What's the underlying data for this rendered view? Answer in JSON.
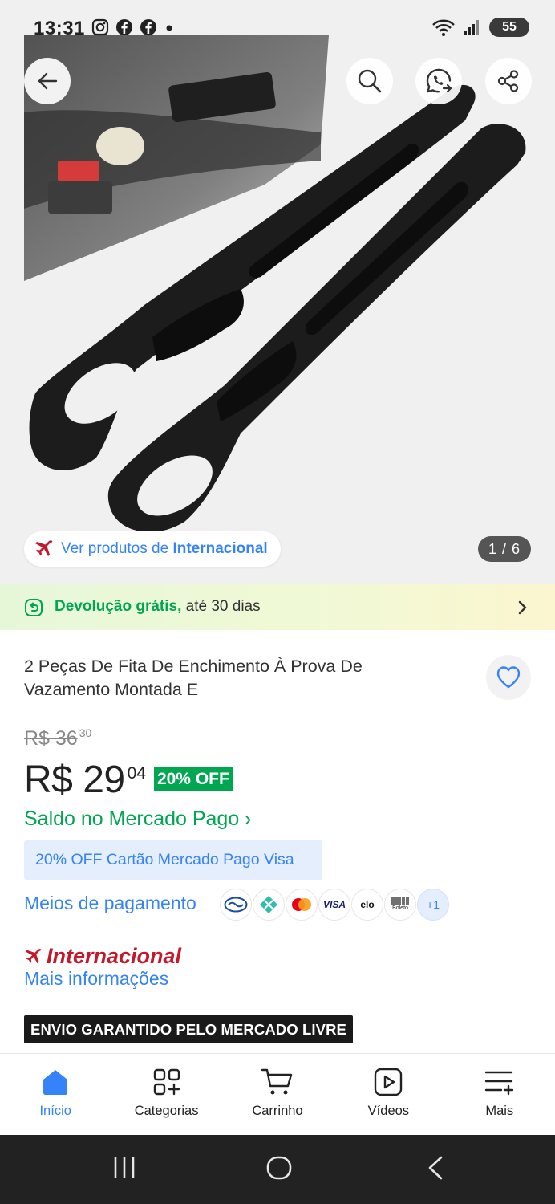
{
  "status_bar": {
    "time": "13:31",
    "battery": "55",
    "left_icons": [
      "instagram-icon",
      "facebook-icon",
      "facebook-icon",
      "dot-icon"
    ],
    "right_icons": [
      "wifi-icon",
      "signal-icon",
      "battery-icon"
    ]
  },
  "gallery": {
    "international_link_prefix": "Ver produtos de ",
    "international_link_bold": "Internacional",
    "counter": "1 / 6"
  },
  "returns_banner": {
    "strong": "Devolução grátis,",
    "rest": " até 30 dias"
  },
  "product": {
    "title": "2 Peças De Fita De Enchimento À Prova De Vazamento Montada E",
    "old_price_main": "R$ 36",
    "old_price_cents": "30",
    "price_main": "R$ 29",
    "price_cents": "04",
    "discount": "20% OFF",
    "saldo": "Saldo no Mercado Pago ›",
    "promo": "20% OFF Cartão Mercado Pago Visa",
    "payment_label": "Meios de pagamento",
    "payment_methods": [
      "mercado-pago-icon",
      "pix-icon",
      "mastercard-icon",
      "VISA",
      "elo",
      "Boleto"
    ],
    "payment_more": "+1",
    "seller_brand": "Internacional",
    "more_info": "Mais informações",
    "shipping_badge": "ENVIO GARANTIDO PELO MERCADO LIVRE"
  },
  "bottom_nav": {
    "items": [
      {
        "label": "Início"
      },
      {
        "label": "Categorias"
      },
      {
        "label": "Carrinho"
      },
      {
        "label": "Vídeos"
      },
      {
        "label": "Mais"
      }
    ]
  },
  "colors": {
    "accent_blue": "#3483fa",
    "green": "#00a650",
    "international_red": "#c4192c"
  }
}
